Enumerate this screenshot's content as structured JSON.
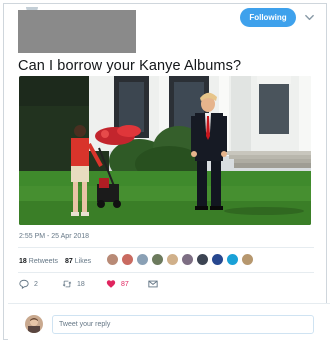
{
  "header": {
    "follow_label": "Following"
  },
  "tweet": {
    "text": "Can I borrow your Kanye Albums?",
    "timestamp": "2:55 PM - 25 Apr 2018"
  },
  "stats": {
    "retweets_count": "18",
    "retweets_label": "Retweets",
    "likes_count": "87",
    "likes_label": "Likes"
  },
  "likers": [
    {
      "color": "#b88a76"
    },
    {
      "color": "#c96a60"
    },
    {
      "color": "#8aa0b5"
    },
    {
      "color": "#6c7a5d"
    },
    {
      "color": "#d0b08a"
    },
    {
      "color": "#7d6e83"
    },
    {
      "color": "#3c4452"
    },
    {
      "color": "#27478f"
    },
    {
      "color": "#1aa1d7"
    },
    {
      "color": "#b6976e"
    }
  ],
  "actions": {
    "reply_count": "2",
    "retweet_count": "18",
    "like_count": "87",
    "reply_icon": "reply-icon",
    "retweet_icon": "retweet-icon",
    "like_icon": "heart-icon",
    "message_icon": "envelope-icon"
  },
  "reply": {
    "placeholder": "Tweet your reply"
  },
  "colors": {
    "accent": "#3ea1ec",
    "like": "#e0245e",
    "muted": "#657786"
  }
}
